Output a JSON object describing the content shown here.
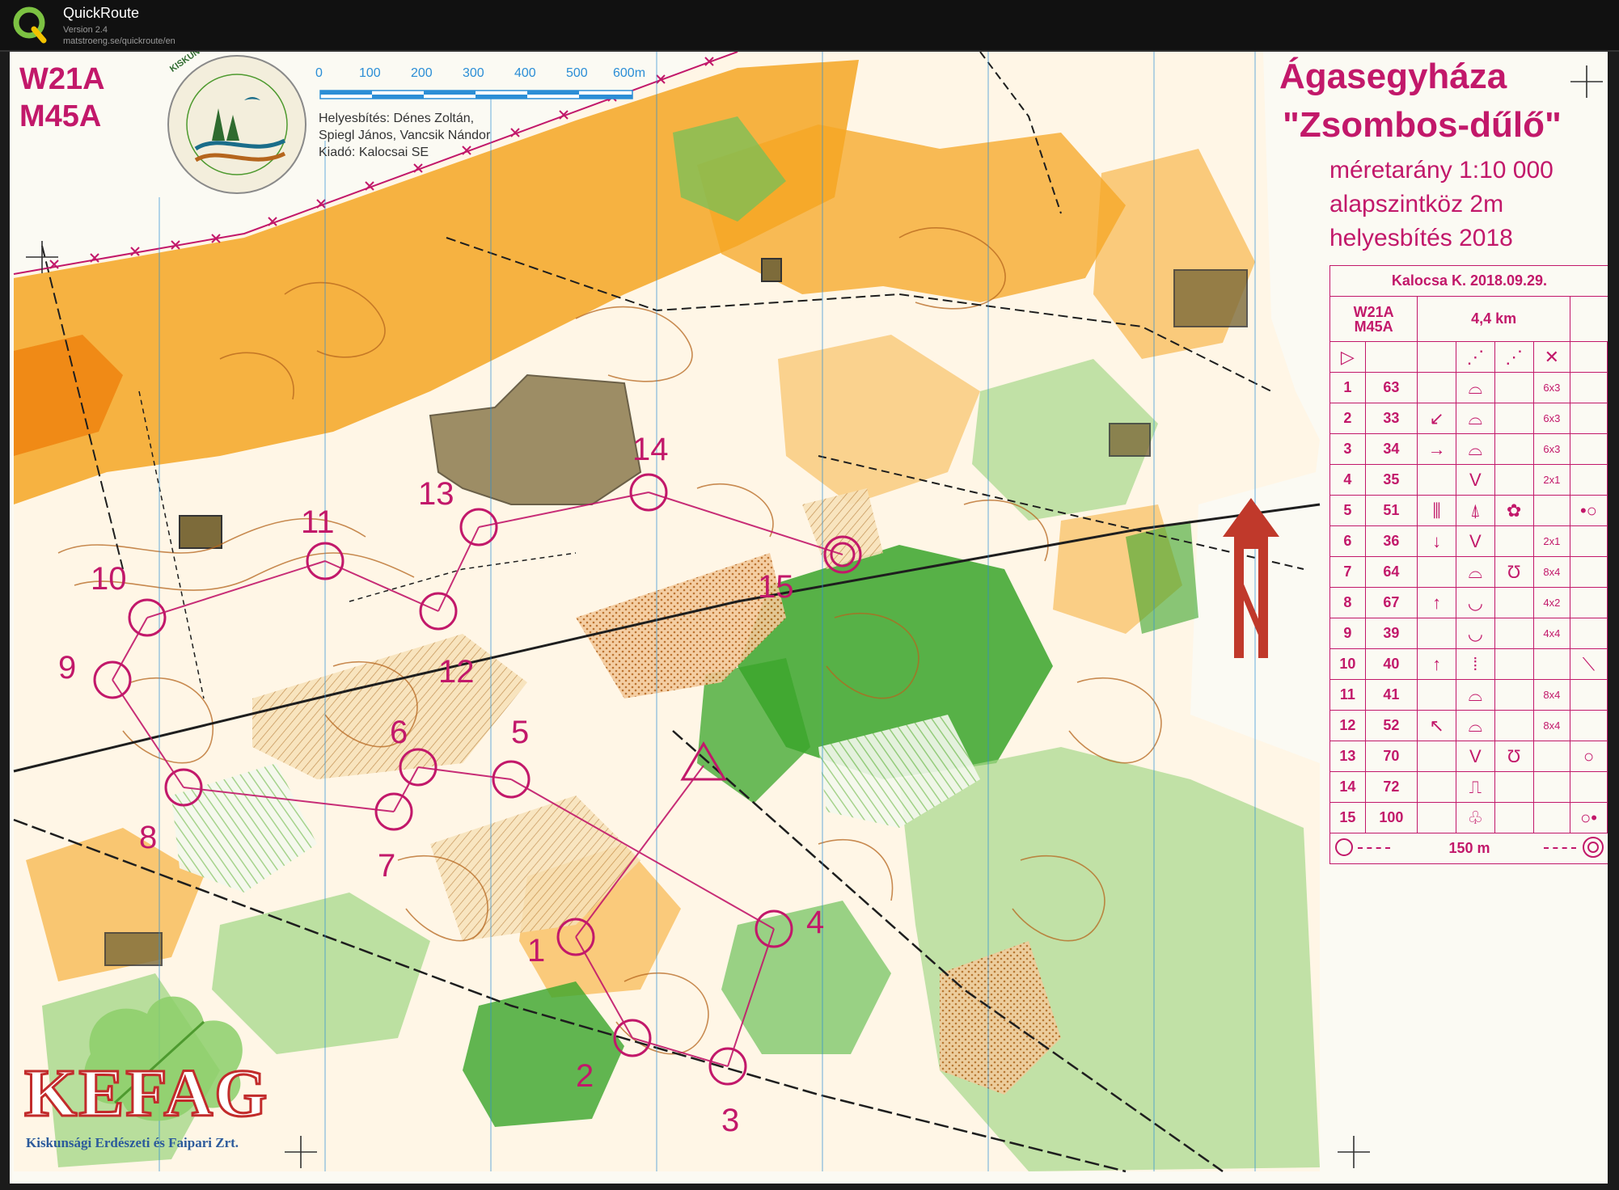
{
  "app": {
    "name": "QuickRoute",
    "version": "Version 2.4",
    "url": "matstroeng.se/quickroute/en"
  },
  "map": {
    "course_codes": [
      "W21A",
      "M45A"
    ],
    "title_line1": "Ágasegyháza",
    "title_line2": "\"Zsombos-dűlő\"",
    "scale_label": "méretarány  1:10 000",
    "contour_label": "alapszintköz  2m",
    "revision_label": "helyesbítés  2018",
    "credits": [
      "Helyesbítés: Dénes Zoltán,",
      "Spiegl János, Vancsik Nándor",
      "Kiadó: Kalocsai SE"
    ],
    "scale_bar_ticks": [
      "0",
      "100",
      "200",
      "300",
      "400",
      "500",
      "600m"
    ],
    "park_logo_text": "KISKUNSÁGI NEMZETI PARK",
    "sponsor_logo": "KEFAG",
    "sponsor_name": "Kiskunsági Erdészeti és Faipari Zrt.",
    "controls": [
      {
        "n": "1"
      },
      {
        "n": "2"
      },
      {
        "n": "3"
      },
      {
        "n": "4"
      },
      {
        "n": "5"
      },
      {
        "n": "6"
      },
      {
        "n": "7"
      },
      {
        "n": "8"
      },
      {
        "n": "9"
      },
      {
        "n": "10"
      },
      {
        "n": "11"
      },
      {
        "n": "12"
      },
      {
        "n": "13"
      },
      {
        "n": "14"
      },
      {
        "n": "15"
      }
    ],
    "colors": {
      "overprint": "#c2186a",
      "open_land": "#f5a623",
      "forest": "#3aa52a",
      "light_green": "#a6d88a",
      "brown": "#b5651d",
      "building": "#7d6b3a",
      "north": "#c0392b",
      "grid": "#2b8ed6"
    }
  },
  "descriptions": {
    "event": "Kalocsa K. 2018.09.29.",
    "course": "W21A\nM45A",
    "length": "4,4 km",
    "rows": [
      {
        "no": "1",
        "code": "63",
        "col_c": "",
        "feature": "⌓",
        "col_e": "",
        "dims": "6x3",
        "extra": ""
      },
      {
        "no": "2",
        "code": "33",
        "col_c": "↙",
        "feature": "⌓",
        "col_e": "",
        "dims": "6x3",
        "extra": ""
      },
      {
        "no": "3",
        "code": "34",
        "col_c": "→",
        "feature": "⌓",
        "col_e": "",
        "dims": "6x3",
        "extra": ""
      },
      {
        "no": "4",
        "code": "35",
        "col_c": "",
        "feature": "V",
        "col_e": "",
        "dims": "2x1",
        "extra": ""
      },
      {
        "no": "5",
        "code": "51",
        "col_c": "⫼",
        "feature": "⍋",
        "col_e": "✿",
        "dims": "",
        "extra": "•○"
      },
      {
        "no": "6",
        "code": "36",
        "col_c": "↓",
        "feature": "V",
        "col_e": "",
        "dims": "2x1",
        "extra": ""
      },
      {
        "no": "7",
        "code": "64",
        "col_c": "",
        "feature": "⌓",
        "col_e": "Ʊ",
        "dims": "8x4",
        "extra": ""
      },
      {
        "no": "8",
        "code": "67",
        "col_c": "↑",
        "feature": "◡",
        "col_e": "",
        "dims": "4x2",
        "extra": ""
      },
      {
        "no": "9",
        "code": "39",
        "col_c": "",
        "feature": "◡",
        "col_e": "",
        "dims": "4x4",
        "extra": ""
      },
      {
        "no": "10",
        "code": "40",
        "col_c": "↑",
        "feature": "⁞",
        "col_e": "",
        "dims": "",
        "extra": "⟍"
      },
      {
        "no": "11",
        "code": "41",
        "col_c": "",
        "feature": "⌓",
        "col_e": "",
        "dims": "8x4",
        "extra": ""
      },
      {
        "no": "12",
        "code": "52",
        "col_c": "↖",
        "feature": "⌓",
        "col_e": "",
        "dims": "8x4",
        "extra": ""
      },
      {
        "no": "13",
        "code": "70",
        "col_c": "",
        "feature": "V",
        "col_e": "Ʊ",
        "dims": "",
        "extra": "○"
      },
      {
        "no": "14",
        "code": "72",
        "col_c": "",
        "feature": "⎍",
        "col_e": "",
        "dims": "",
        "extra": ""
      },
      {
        "no": "15",
        "code": "100",
        "col_c": "",
        "feature": "♧",
        "col_e": "",
        "dims": "",
        "extra": "○•"
      }
    ],
    "finish_label": "150 m"
  }
}
